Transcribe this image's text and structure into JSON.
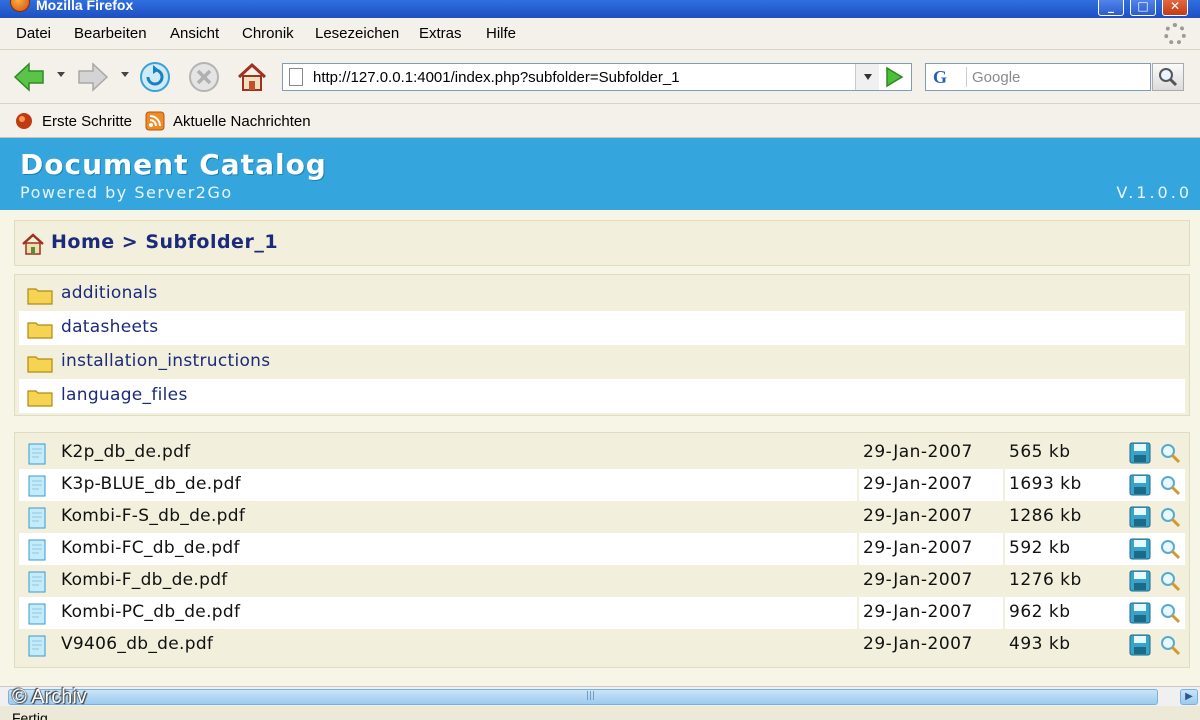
{
  "window": {
    "title": "Mozilla Firefox",
    "buttons": [
      "_",
      "□",
      "✕"
    ]
  },
  "menu": {
    "items": [
      "Datei",
      "Bearbeiten",
      "Ansicht",
      "Chronik",
      "Lesezeichen",
      "Extras",
      "Hilfe"
    ]
  },
  "nav": {
    "url": "http://127.0.0.1:4001/index.php?subfolder=Subfolder_1",
    "search_engine": "G",
    "search_placeholder": "Google"
  },
  "bookmarks": {
    "items": [
      "Erste Schritte",
      "Aktuelle Nachrichten"
    ]
  },
  "page": {
    "title": "Document Catalog",
    "subtitle": "Powered by Server2Go",
    "version": "V.1.0.0",
    "breadcrumb": {
      "home": "Home",
      "separator": ">",
      "current": "Subfolder_1"
    },
    "folders": [
      "additionals",
      "datasheets",
      "installation_instructions",
      "language_files"
    ],
    "files": [
      {
        "name": "K2p_db_de.pdf",
        "date": "29-Jan-2007",
        "size": "565 kb"
      },
      {
        "name": "K3p-BLUE_db_de.pdf",
        "date": "29-Jan-2007",
        "size": "1693 kb"
      },
      {
        "name": "Kombi-F-S_db_de.pdf",
        "date": "29-Jan-2007",
        "size": "1286 kb"
      },
      {
        "name": "Kombi-FC_db_de.pdf",
        "date": "29-Jan-2007",
        "size": "592 kb"
      },
      {
        "name": "Kombi-F_db_de.pdf",
        "date": "29-Jan-2007",
        "size": "1276 kb"
      },
      {
        "name": "Kombi-PC_db_de.pdf",
        "date": "29-Jan-2007",
        "size": "962 kb"
      },
      {
        "name": "V9406_db_de.pdf",
        "date": "29-Jan-2007",
        "size": "493 kb"
      }
    ]
  },
  "watermark": "© Archiv",
  "status": "Fertig",
  "colors": {
    "header": "#35a6dd",
    "panel": "#f2efdc",
    "link": "#1b2a7a"
  }
}
